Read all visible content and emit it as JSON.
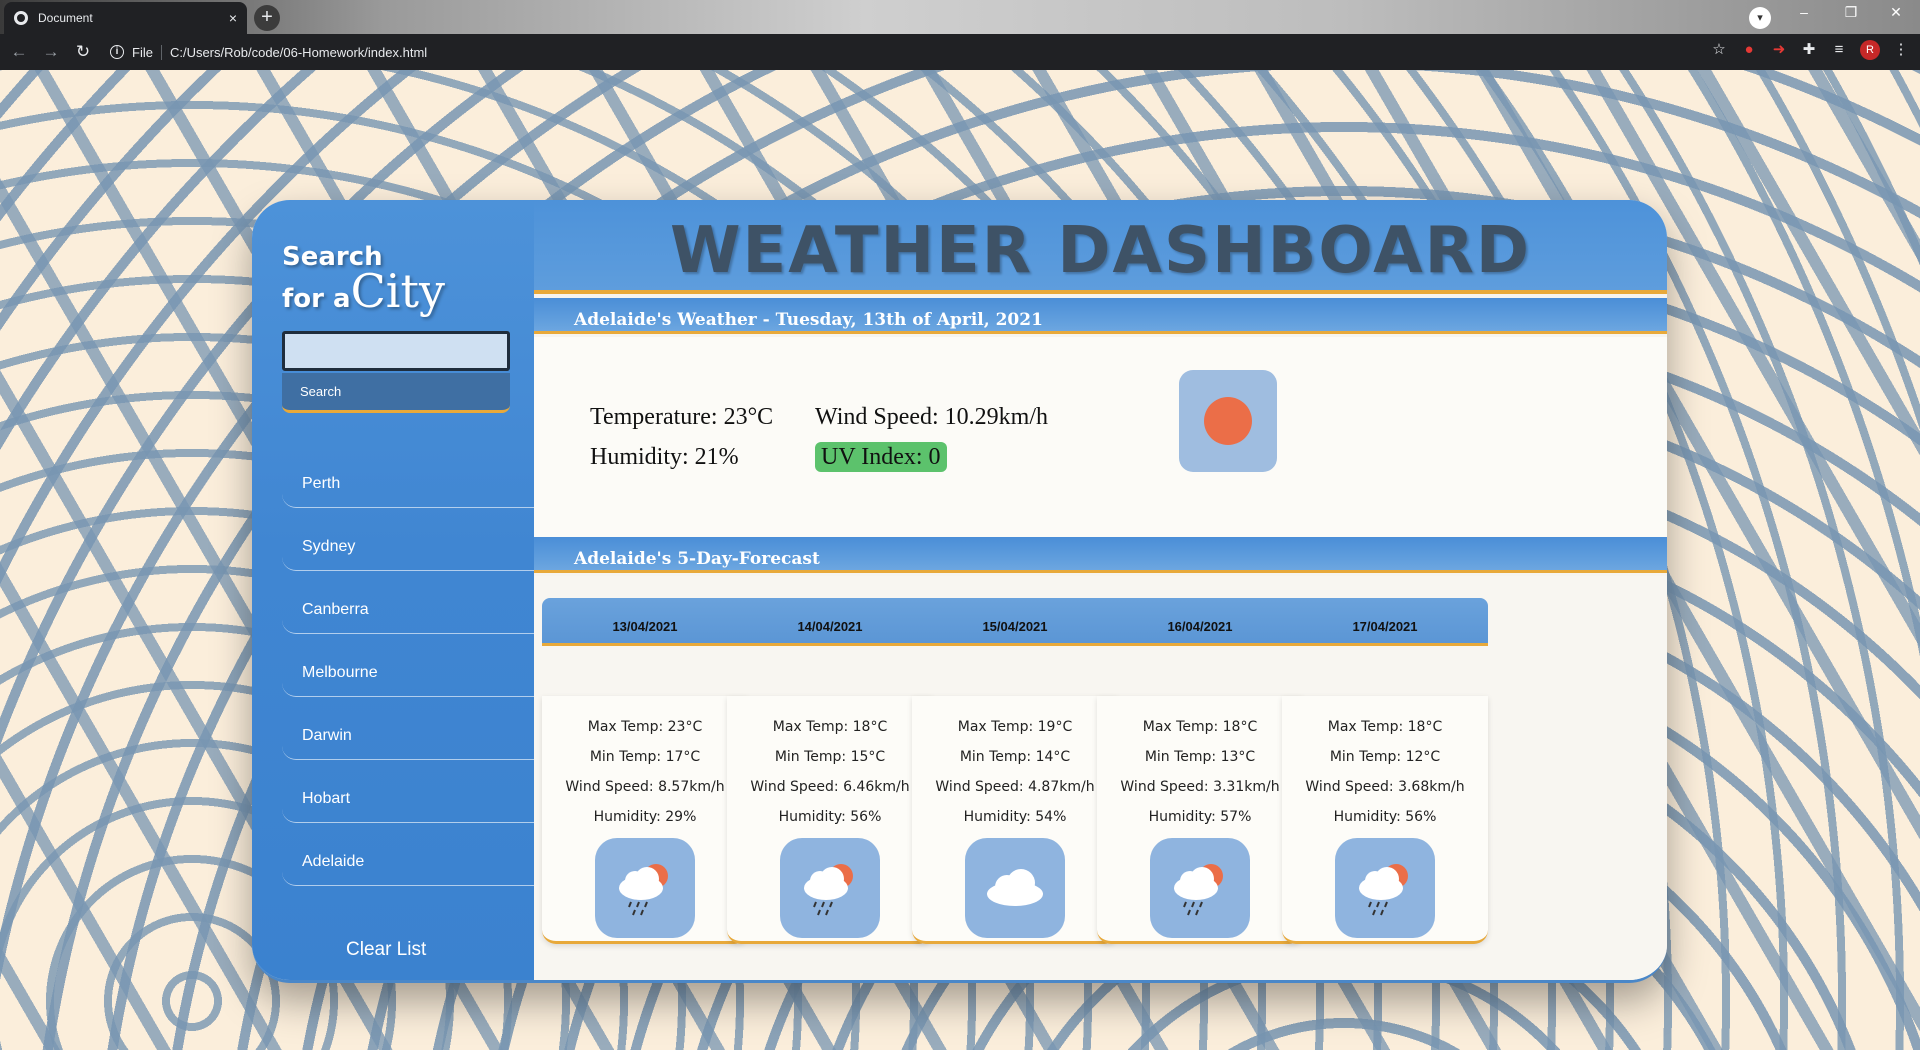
{
  "browser": {
    "tab_title": "Document",
    "tab_close": "×",
    "new_tab": "+",
    "file_label": "File",
    "url": "C:/Users/Rob/code/06-Homework/index.html",
    "window_controls": [
      "–",
      "❐",
      "✕"
    ],
    "profile_initial": "R"
  },
  "sidebar": {
    "title_line1": "Search",
    "title_line2_prefix": "for a",
    "title_line2_big": "City",
    "search_value": "",
    "search_button": "Search",
    "cities": [
      "Perth",
      "Sydney",
      "Canberra",
      "Melbourne",
      "Darwin",
      "Hobart",
      "Adelaide"
    ],
    "clear_button": "Clear List"
  },
  "header": {
    "title": "WEATHER DASHBOARD"
  },
  "current": {
    "heading": "Adelaide's Weather - Tuesday, 13th of April, 2021",
    "temperature": "Temperature: 23°C",
    "humidity": "Humidity: 21%",
    "wind": "Wind Speed: 10.29km/h",
    "uv": "UV Index: 0",
    "uv_color": "#5cc26c",
    "icon": "sun-icon"
  },
  "forecast": {
    "heading": "Adelaide's 5-Day-Forecast",
    "days": [
      {
        "date": "13/04/2021",
        "max": "Max Temp: 23°C",
        "min": "Min Temp: 17°C",
        "wind": "Wind Speed: 8.57km/h",
        "humidity": "Humidity: 29%",
        "icon": "rain-sun-icon"
      },
      {
        "date": "14/04/2021",
        "max": "Max Temp: 18°C",
        "min": "Min Temp: 15°C",
        "wind": "Wind Speed: 6.46km/h",
        "humidity": "Humidity: 56%",
        "icon": "rain-sun-icon"
      },
      {
        "date": "15/04/2021",
        "max": "Max Temp: 19°C",
        "min": "Min Temp: 14°C",
        "wind": "Wind Speed: 4.87km/h",
        "humidity": "Humidity: 54%",
        "icon": "cloud-icon"
      },
      {
        "date": "16/04/2021",
        "max": "Max Temp: 18°C",
        "min": "Min Temp: 13°C",
        "wind": "Wind Speed: 3.31km/h",
        "humidity": "Humidity: 57%",
        "icon": "rain-sun-icon"
      },
      {
        "date": "17/04/2021",
        "max": "Max Temp: 18°C",
        "min": "Min Temp: 12°C",
        "wind": "Wind Speed: 3.68km/h",
        "humidity": "Humidity: 56%",
        "icon": "rain-sun-icon"
      }
    ]
  },
  "colors": {
    "accent": "#e8a93a",
    "primary": "#4a8ed7",
    "sun": "#eb6e48"
  }
}
